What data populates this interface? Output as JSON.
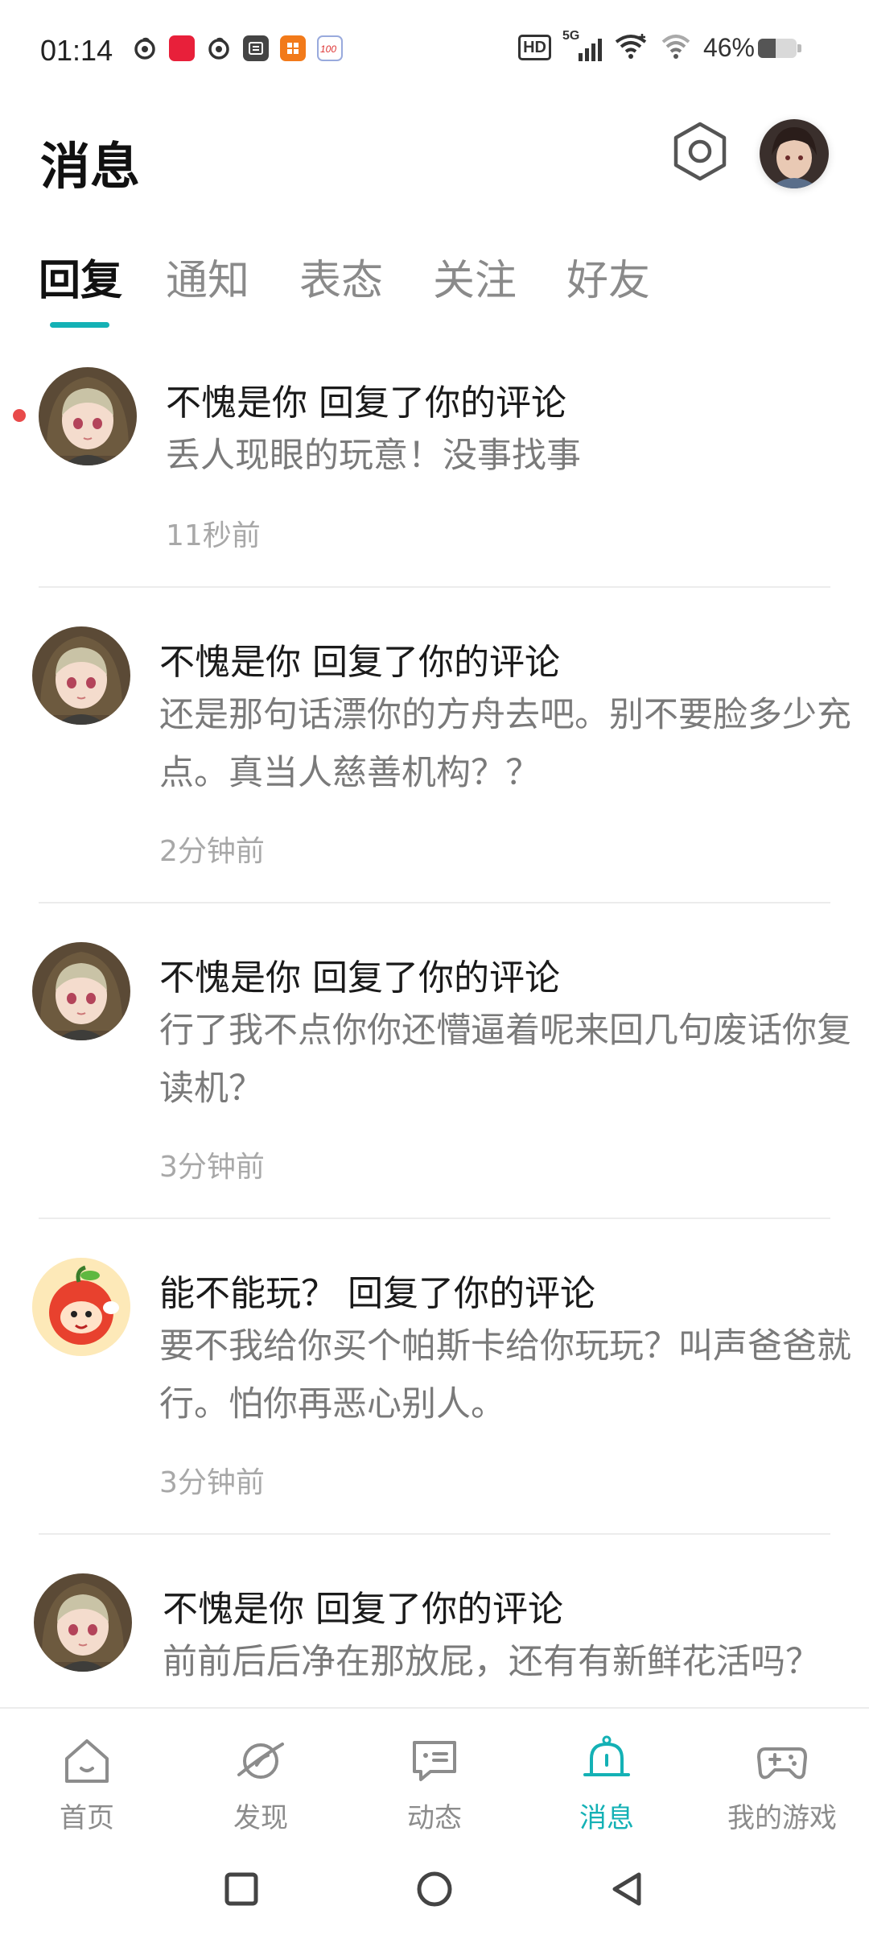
{
  "status_bar": {
    "time": "01:14",
    "hd_label": "HD",
    "network": "5G",
    "battery_percent": "46%",
    "battery_level": 0.46
  },
  "header": {
    "title": "消息"
  },
  "tabs": [
    {
      "label": "回复",
      "active": true
    },
    {
      "label": "通知",
      "active": false
    },
    {
      "label": "表态",
      "active": false
    },
    {
      "label": "关注",
      "active": false
    },
    {
      "label": "好友",
      "active": false
    }
  ],
  "messages": [
    {
      "title": "不愧是你 回复了你的评论",
      "body": "丢人现眼的玩意！没事找事",
      "time": "11秒前",
      "unread": true,
      "avatar": "hooded-girl-avatar"
    },
    {
      "title": "不愧是你 回复了你的评论",
      "body": "还是那句话漂你的方舟去吧。别不要脸多少充点。真当人慈善机构？？",
      "time": "2分钟前",
      "unread": false,
      "avatar": "hooded-girl-avatar"
    },
    {
      "title": "不愧是你 回复了你的评论",
      "body": "行了我不点你你还懵逼着呢来回几句废话你复读机？",
      "time": "3分钟前",
      "unread": false,
      "avatar": "hooded-girl-avatar"
    },
    {
      "title": "能不能玩？ 回复了你的评论",
      "body": "要不我给你买个帕斯卡给你玩玩？叫声爸爸就行。怕你再恶心别人。",
      "time": "3分钟前",
      "unread": false,
      "avatar": "cartoon-apple-avatar"
    },
    {
      "title": "不愧是你 回复了你的评论",
      "body": "前前后后净在那放屁，还有有新鲜花活吗？",
      "time": "",
      "unread": false,
      "avatar": "hooded-girl-avatar"
    }
  ],
  "bottom_nav": [
    {
      "label": "首页",
      "icon": "home-icon",
      "active": false
    },
    {
      "label": "发现",
      "icon": "planet-icon",
      "active": false
    },
    {
      "label": "动态",
      "icon": "chat-icon",
      "active": false
    },
    {
      "label": "消息",
      "icon": "bell-icon",
      "active": true
    },
    {
      "label": "我的游戏",
      "icon": "gamepad-icon",
      "active": false
    }
  ],
  "colors": {
    "accent": "#14b1b5",
    "unread_dot": "#e84a4a"
  }
}
